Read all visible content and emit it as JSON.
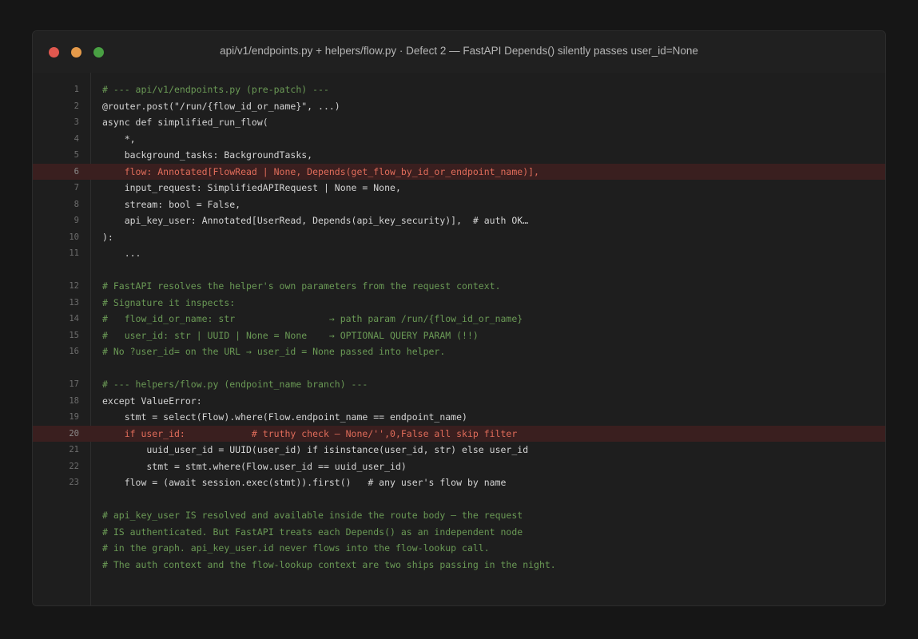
{
  "window": {
    "title": "api/v1/endpoints.py + helpers/flow.py  ·  Defect 2 — FastAPI Depends() silently passes user_id=None"
  },
  "colors": {
    "background": "#161616",
    "editor": "#1e1e1e",
    "comment": "#6a9955",
    "highlight_bg": "#3a1f1f",
    "highlight_text": "#e06c5a",
    "close": "#e0584f",
    "minimize": "#e59a4a",
    "maximize": "#49a043"
  },
  "lines": [
    {
      "num": "1",
      "text": "# --- api/v1/endpoints.py (pre-patch) ---",
      "type": "comment"
    },
    {
      "num": "2",
      "text": "@router.post(\"/run/{flow_id_or_name}\", ...)",
      "type": "code"
    },
    {
      "num": "3",
      "text": "async def simplified_run_flow(",
      "type": "code"
    },
    {
      "num": "4",
      "text": "    *,",
      "type": "code"
    },
    {
      "num": "5",
      "text": "    background_tasks: BackgroundTasks,",
      "type": "code"
    },
    {
      "num": "6",
      "text": "    flow: Annotated[FlowRead | None, Depends(get_flow_by_id_or_endpoint_name)],",
      "type": "highlight"
    },
    {
      "num": "7",
      "text": "    input_request: SimplifiedAPIRequest | None = None,",
      "type": "code"
    },
    {
      "num": "8",
      "text": "    stream: bool = False,",
      "type": "code"
    },
    {
      "num": "9",
      "text": "    api_key_user: Annotated[UserRead, Depends(api_key_security)],  # auth OK…",
      "type": "code"
    },
    {
      "num": "10",
      "text": "):",
      "type": "code"
    },
    {
      "num": "11",
      "text": "    ...",
      "type": "code"
    },
    {
      "num": "",
      "text": "",
      "type": "blank"
    },
    {
      "num": "12",
      "text": "# FastAPI resolves the helper's own parameters from the request context.",
      "type": "comment"
    },
    {
      "num": "13",
      "text": "# Signature it inspects:",
      "type": "comment"
    },
    {
      "num": "14",
      "text": "#   flow_id_or_name: str                 → path param /run/{flow_id_or_name}",
      "type": "comment"
    },
    {
      "num": "15",
      "text": "#   user_id: str | UUID | None = None    → OPTIONAL QUERY PARAM (!!)",
      "type": "comment"
    },
    {
      "num": "16",
      "text": "# No ?user_id= on the URL → user_id = None passed into helper.",
      "type": "comment"
    },
    {
      "num": "",
      "text": "",
      "type": "blank"
    },
    {
      "num": "17",
      "text": "# --- helpers/flow.py (endpoint_name branch) ---",
      "type": "comment"
    },
    {
      "num": "18",
      "text": "except ValueError:",
      "type": "code"
    },
    {
      "num": "19",
      "text": "    stmt = select(Flow).where(Flow.endpoint_name == endpoint_name)",
      "type": "code"
    },
    {
      "num": "20",
      "text": "    if user_id:            # truthy check — None/'',0,False all skip filter",
      "type": "highlight"
    },
    {
      "num": "21",
      "text": "        uuid_user_id = UUID(user_id) if isinstance(user_id, str) else user_id",
      "type": "code"
    },
    {
      "num": "22",
      "text": "        stmt = stmt.where(Flow.user_id == uuid_user_id)",
      "type": "code"
    },
    {
      "num": "23",
      "text": "    flow = (await session.exec(stmt)).first()   # any user's flow by name",
      "type": "code"
    },
    {
      "num": "",
      "text": "",
      "type": "blank"
    },
    {
      "num": "",
      "text": "# api_key_user IS resolved and available inside the route body — the request",
      "type": "comment"
    },
    {
      "num": "",
      "text": "# IS authenticated. But FastAPI treats each Depends() as an independent node",
      "type": "comment"
    },
    {
      "num": "",
      "text": "# in the graph. api_key_user.id never flows into the flow-lookup call.",
      "type": "comment"
    },
    {
      "num": "",
      "text": "# The auth context and the flow-lookup context are two ships passing in the night.",
      "type": "comment"
    }
  ]
}
